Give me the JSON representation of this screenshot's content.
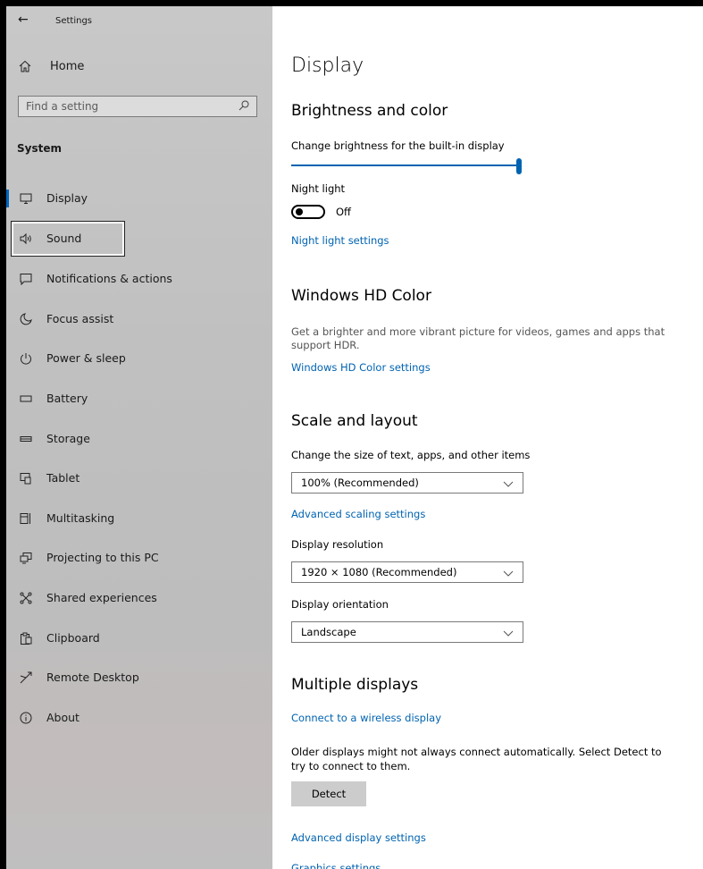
{
  "window": {
    "title": "Settings"
  },
  "sidebar": {
    "home_label": "Home",
    "search_placeholder": "Find a setting",
    "section": "System",
    "items": [
      {
        "label": "Display",
        "icon": "monitor-icon"
      },
      {
        "label": "Sound",
        "icon": "speaker-icon"
      },
      {
        "label": "Notifications & actions",
        "icon": "notification-icon"
      },
      {
        "label": "Focus assist",
        "icon": "moon-icon"
      },
      {
        "label": "Power & sleep",
        "icon": "power-icon"
      },
      {
        "label": "Battery",
        "icon": "battery-icon"
      },
      {
        "label": "Storage",
        "icon": "storage-icon"
      },
      {
        "label": "Tablet",
        "icon": "tablet-icon"
      },
      {
        "label": "Multitasking",
        "icon": "multitasking-icon"
      },
      {
        "label": "Projecting to this PC",
        "icon": "projecting-icon"
      },
      {
        "label": "Shared experiences",
        "icon": "shared-icon"
      },
      {
        "label": "Clipboard",
        "icon": "clipboard-icon"
      },
      {
        "label": "Remote Desktop",
        "icon": "remote-desktop-icon"
      },
      {
        "label": "About",
        "icon": "info-icon"
      }
    ],
    "selected": "Display",
    "focused": "Sound"
  },
  "main": {
    "title": "Display",
    "brightness": {
      "heading": "Brightness and color",
      "slider_label": "Change brightness for the built-in display",
      "slider_value": 1.0,
      "night_light_label": "Night light",
      "night_light_state": "Off",
      "night_light_link": "Night light settings"
    },
    "hdr": {
      "heading": "Windows HD Color",
      "description": "Get a brighter and more vibrant picture for videos, games and apps that support HDR.",
      "link": "Windows HD Color settings"
    },
    "scale": {
      "heading": "Scale and layout",
      "size_label": "Change the size of text, apps, and other items",
      "size_value": "100% (Recommended)",
      "advanced_link": "Advanced scaling settings",
      "resolution_label": "Display resolution",
      "resolution_value": "1920 × 1080 (Recommended)",
      "orientation_label": "Display orientation",
      "orientation_value": "Landscape"
    },
    "multiple": {
      "heading": "Multiple displays",
      "wireless_link": "Connect to a wireless display",
      "detect_text": "Older displays might not always connect automatically. Select Detect to try to connect to them.",
      "detect_button": "Detect",
      "advanced_link": "Advanced display settings",
      "graphics_link": "Graphics settings"
    }
  },
  "colors": {
    "accent": "#0063b1",
    "sidebar_bg": "#c4c4c4"
  }
}
